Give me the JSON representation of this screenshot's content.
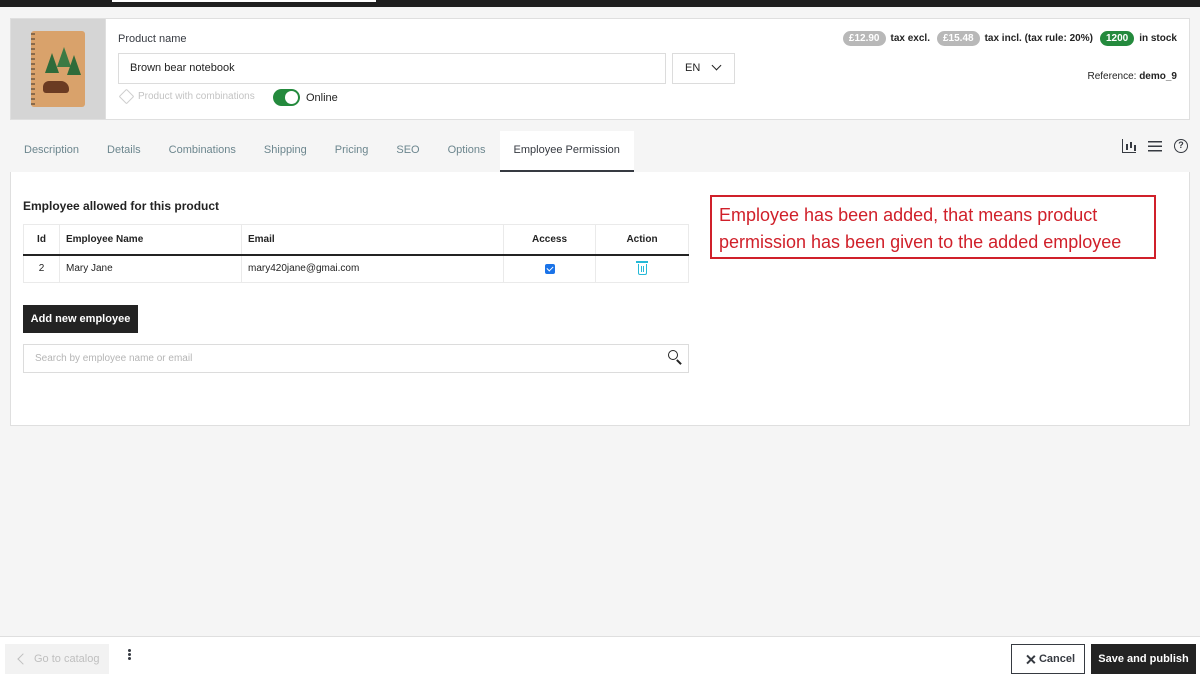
{
  "header": {
    "product_name_label": "Product name",
    "product_name_value": "Brown bear notebook",
    "language": "EN",
    "combinations_label": "Product with combinations",
    "online_label": "Online",
    "price_excl": "£12.90",
    "price_excl_label": "tax excl.",
    "price_incl": "£15.48",
    "price_incl_label": "tax incl. (tax rule: 20%)",
    "stock": "1200",
    "stock_label": "in stock",
    "reference_label": "Reference:",
    "reference_value": "demo_9"
  },
  "tabs": [
    {
      "label": "Description"
    },
    {
      "label": "Details"
    },
    {
      "label": "Combinations"
    },
    {
      "label": "Shipping"
    },
    {
      "label": "Pricing"
    },
    {
      "label": "SEO"
    },
    {
      "label": "Options"
    },
    {
      "label": "Employee Permission",
      "active": true
    }
  ],
  "permission": {
    "title": "Employee allowed for this product",
    "columns": [
      "Id",
      "Employee Name",
      "Email",
      "Access",
      "Action"
    ],
    "rows": [
      {
        "id": "2",
        "name": "Mary Jane",
        "email": "mary420jane@gmai.com",
        "access": true
      }
    ],
    "add_button": "Add new employee",
    "search_placeholder": "Search by employee name or email"
  },
  "annotation": "Employee has been added, that means product permission has been given to the added employee",
  "footer": {
    "go_to_catalog": "Go to catalog",
    "cancel": "Cancel",
    "save_publish": "Save and publish"
  },
  "colors": {
    "accent_green": "#248a3d",
    "annotation_red": "#d0202a",
    "icon_blue": "#25b9d7"
  },
  "icons": [
    "layers-icon",
    "chevron-down-icon",
    "chart-icon",
    "list-icon",
    "help-icon",
    "trash-icon",
    "search-icon",
    "chevron-left-icon",
    "kebab-icon",
    "close-icon"
  ]
}
